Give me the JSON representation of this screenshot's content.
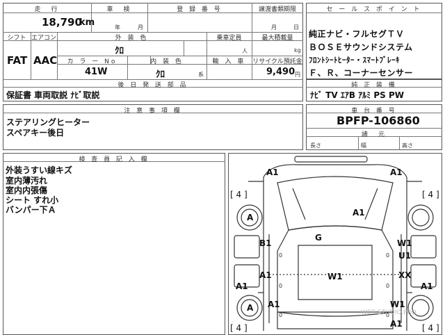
{
  "header": {
    "mileage_label": "走　行",
    "shaken_label": "車　検",
    "reg_label": "登 録 番 号",
    "transfer_label": "譲渡書類期限",
    "sales_label": "セ ー ル ス ポ イ ン ト",
    "mileage": "18,790",
    "mileage_unit": "km",
    "year_unit": "年",
    "month_unit": "月",
    "transfer_month": "月",
    "transfer_day": "日"
  },
  "row2": {
    "shift_label": "シフト",
    "ac_label": "エアコン",
    "ext_color_label": "外 装 色",
    "capacity_label": "乗車定員",
    "max_load_label": "最大積載量",
    "shift": "FAT",
    "ac": "AAC",
    "ext_color": "ｸﾛ",
    "capacity_unit": "人",
    "load_unit": "kg",
    "color_no_label": "カ ラ ー No",
    "int_color_label": "内 装 色",
    "import_label": "輸 入 車",
    "recycle_label": "リサイクル預託金",
    "color_no": "41W",
    "int_color": "ｸﾛ",
    "int_color_unit": "系",
    "recycle": "9,490",
    "recycle_unit": "円"
  },
  "sales_points": [
    "純正ナビ・フルセグＴＶ",
    "ＢＯＳＥサウンドシステム",
    "ﾌﾛﾝﾄｼｰﾄﾋｰﾀｰ・ｽﾏｰﾄﾌﾞﾚｰｷ",
    "Ｆ、Ｒ、コーナーセンサー"
  ],
  "later_docs": {
    "label": "後 日 発 送 部 品",
    "value": "保証書 車両取説 ﾅﾋﾞ取説"
  },
  "equipment": {
    "label": "純 正 装 備",
    "value": "ﾅﾋﾞ TV ｴｱB ｱﾙﾐ PS PW"
  },
  "notes": {
    "label": "注 意 事 項 欄",
    "lines": [
      "ステアリングヒーター",
      "スペアキー後日"
    ]
  },
  "chassis": {
    "label": "車 台 番 号",
    "value": "BPFP-106860",
    "dims_label": "諸　元",
    "length_label": "長さ",
    "width_label": "幅",
    "height_label": "高さ"
  },
  "inspector": {
    "label": "検 査 員 記 入 欄",
    "lines": [
      "外装うすい線キズ",
      "室内薄汚れ",
      "室内内張傷",
      "シート すれ小",
      "バンパー下Ａ"
    ]
  },
  "diagram": {
    "marks": {
      "a1_front_left": "A1",
      "a1_front_right": "A1",
      "bracket_left_top": "[ 4 ]",
      "bracket_right_top": "[ 4 ]",
      "bracket_left_bottom": "[ 4 ]",
      "bracket_right_bottom": "[ 4 ]",
      "wheel_front_left": "A",
      "wheel_rear_left": "A",
      "hood": "A1",
      "windshield": "G",
      "door_fl": "B1",
      "fender_fr": "W1",
      "door_fr": "U1",
      "door_rl": "A1",
      "roof": "W1",
      "door_rr": "XX",
      "side_left": "A1",
      "side_right": "A1",
      "rear_left": "A1",
      "rear_right": "W1",
      "bottom_right": "A1",
      "zero_1": "0",
      "zero_2": "0",
      "zero_3": "0",
      "zero_4": "0",
      "zero_5": "0",
      "zero_6": "0"
    },
    "watermark": "WEB-STUDIO.PRO"
  }
}
